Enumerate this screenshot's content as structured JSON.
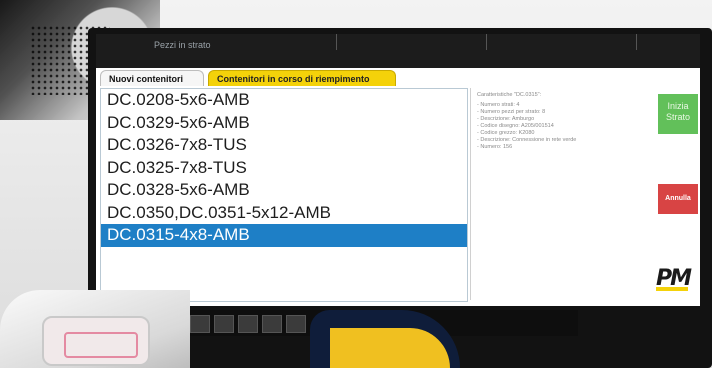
{
  "status_strip": {
    "label": "Pezzi in strato"
  },
  "tabs": [
    {
      "label": "Nuovi contenitori",
      "active": true
    },
    {
      "label": "Contenitori in corso di riempimento",
      "active": false
    }
  ],
  "container_list": {
    "items": [
      "DC.0208-5x6-AMB",
      "DC.0329-5x6-AMB",
      "DC.0326-7x8-TUS",
      "DC.0325-7x8-TUS",
      "DC.0328-5x6-AMB",
      "DC.0350,DC.0351-5x12-AMB",
      "DC.0315-4x8-AMB"
    ],
    "selected_index": 6
  },
  "details": {
    "title": "Caratteristiche \"DC.0315\":",
    "lines": [
      "- Numero strati: 4",
      "- Numero pezzi per strato: 8",
      "- Descrizione: Amburgo",
      "- Codice disegno: A205/001514",
      "- Codice grezzo: K2080",
      "- Descrizione: Connessione in rete verde",
      "- Numero: 156"
    ]
  },
  "buttons": {
    "start": "Inizia Strato",
    "cancel": "Annulla"
  },
  "logo": {
    "text": "PM"
  },
  "colors": {
    "selected_row": "#1e7fc6",
    "tab_filling": "#f4d20a",
    "start_button": "#62c05a",
    "cancel_button": "#d84444"
  }
}
